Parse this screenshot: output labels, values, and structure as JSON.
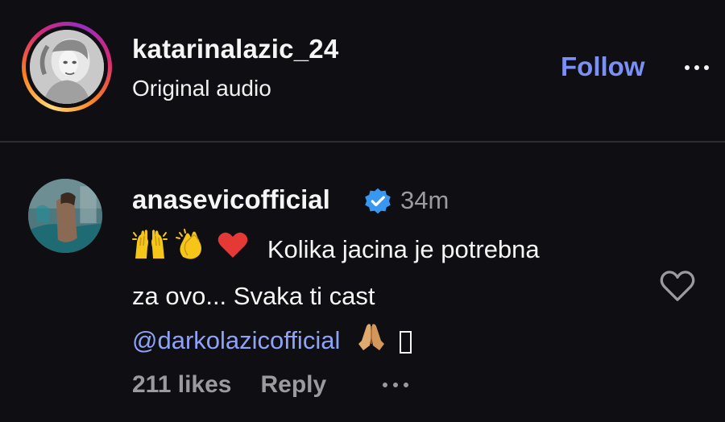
{
  "post": {
    "username": "katarinalazic_24",
    "subtitle": "Original audio",
    "follow_label": "Follow",
    "avatar_icon": "profile-photo",
    "more_icon": "more-options-icon"
  },
  "comment": {
    "username": "anasevicofficial",
    "verified_icon": "verified-badge-icon",
    "time": "34m",
    "emoji": [
      "raising-hands-emoji",
      "clapping-hands-emoji",
      "red-heart-emoji"
    ],
    "text_line1": "Kolika jacina je potrebna",
    "text_line2": "za ovo... Svaka ti cast",
    "mention": "@darkolazicofficial",
    "trailing_emoji": "folded-hands-emoji",
    "likes": "211 likes",
    "reply_label": "Reply",
    "like_icon": "heart-outline-icon"
  },
  "colors": {
    "background": "#0f0f13",
    "follow_blue": "#7b8ff5",
    "mention_blue": "#8ea2f8",
    "verified_blue": "#3897f0",
    "muted": "#9a9a9f"
  }
}
